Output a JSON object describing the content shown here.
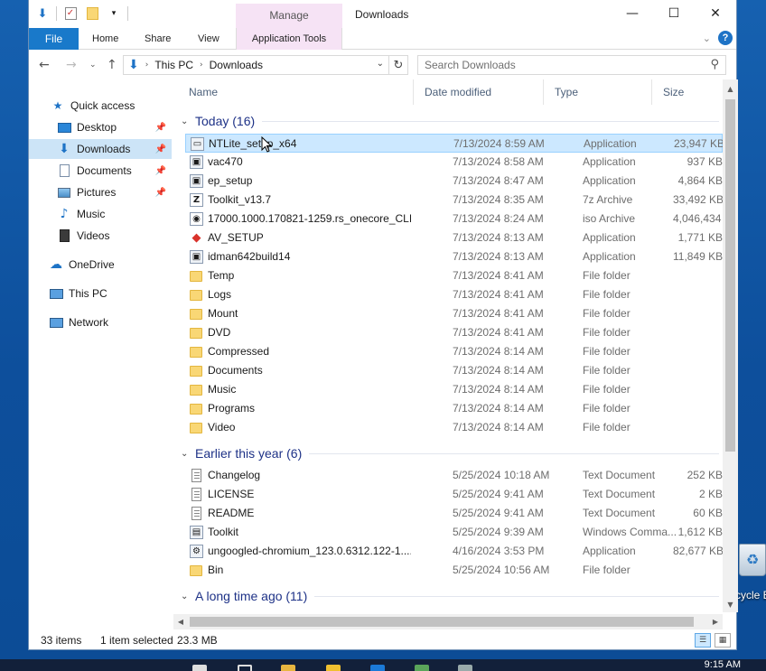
{
  "window": {
    "title": "Downloads",
    "manage_tab": "Manage",
    "minimize_glyph": "—",
    "maximize_glyph": "☐",
    "close_glyph": "✕"
  },
  "ribbon": {
    "file": "File",
    "home": "Home",
    "share": "Share",
    "view": "View",
    "app_tools": "Application Tools",
    "help": "?"
  },
  "address": {
    "crumbs": [
      "This PC",
      "Downloads"
    ],
    "search_placeholder": "Search Downloads"
  },
  "nav": {
    "quick_access": "Quick access",
    "desktop": "Desktop",
    "downloads": "Downloads",
    "documents": "Documents",
    "pictures": "Pictures",
    "music": "Music",
    "videos": "Videos",
    "onedrive": "OneDrive",
    "this_pc": "This PC",
    "network": "Network"
  },
  "columns": {
    "name": "Name",
    "date": "Date modified",
    "type": "Type",
    "size": "Size"
  },
  "groups": {
    "today": "Today (16)",
    "earlier": "Earlier this year (6)",
    "long_ago": "A long time ago (11)"
  },
  "rows": [
    {
      "name": "NTLite_setup_x64",
      "date": "7/13/2024 8:59 AM",
      "type": "Application",
      "size": "23,947 KB",
      "icon": "installer-icon"
    },
    {
      "name": "vac470",
      "date": "7/13/2024 8:58 AM",
      "type": "Application",
      "size": "937 KB",
      "icon": "app-icon"
    },
    {
      "name": "ep_setup",
      "date": "7/13/2024 8:47 AM",
      "type": "Application",
      "size": "4,864 KB",
      "icon": "app-icon"
    },
    {
      "name": "Toolkit_v13.7",
      "date": "7/13/2024 8:35 AM",
      "type": "7z Archive",
      "size": "33,492 KB",
      "icon": "archive-icon"
    },
    {
      "name": "17000.1000.170821-1259.rs_onecore_CLIE...",
      "date": "7/13/2024 8:24 AM",
      "type": "iso Archive",
      "size": "4,046,434 KB",
      "icon": "iso-icon"
    },
    {
      "name": "AV_SETUP",
      "date": "7/13/2024 8:13 AM",
      "type": "Application",
      "size": "1,771 KB",
      "icon": "av-icon"
    },
    {
      "name": "idman642build14",
      "date": "7/13/2024 8:13 AM",
      "type": "Application",
      "size": "11,849 KB",
      "icon": "app-icon"
    },
    {
      "name": "Temp",
      "date": "7/13/2024 8:41 AM",
      "type": "File folder",
      "size": "",
      "icon": "folder-icon"
    },
    {
      "name": "Logs",
      "date": "7/13/2024 8:41 AM",
      "type": "File folder",
      "size": "",
      "icon": "folder-icon"
    },
    {
      "name": "Mount",
      "date": "7/13/2024 8:41 AM",
      "type": "File folder",
      "size": "",
      "icon": "folder-icon"
    },
    {
      "name": "DVD",
      "date": "7/13/2024 8:41 AM",
      "type": "File folder",
      "size": "",
      "icon": "folder-icon"
    },
    {
      "name": "Compressed",
      "date": "7/13/2024 8:14 AM",
      "type": "File folder",
      "size": "",
      "icon": "folder-icon"
    },
    {
      "name": "Documents",
      "date": "7/13/2024 8:14 AM",
      "type": "File folder",
      "size": "",
      "icon": "folder-icon"
    },
    {
      "name": "Music",
      "date": "7/13/2024 8:14 AM",
      "type": "File folder",
      "size": "",
      "icon": "folder-icon"
    },
    {
      "name": "Programs",
      "date": "7/13/2024 8:14 AM",
      "type": "File folder",
      "size": "",
      "icon": "folder-icon"
    },
    {
      "name": "Video",
      "date": "7/13/2024 8:14 AM",
      "type": "File folder",
      "size": "",
      "icon": "folder-icon"
    },
    {
      "name": "Changelog",
      "date": "5/25/2024 10:18 AM",
      "type": "Text Document",
      "size": "252 KB",
      "icon": "text-document-icon"
    },
    {
      "name": "LICENSE",
      "date": "5/25/2024 9:41 AM",
      "type": "Text Document",
      "size": "2 KB",
      "icon": "text-document-icon"
    },
    {
      "name": "README",
      "date": "5/25/2024 9:41 AM",
      "type": "Text Document",
      "size": "60 KB",
      "icon": "text-document-icon"
    },
    {
      "name": "Toolkit",
      "date": "5/25/2024 9:39 AM",
      "type": "Windows Comma...",
      "size": "1,612 KB",
      "icon": "command-script-icon"
    },
    {
      "name": "ungoogled-chromium_123.0.6312.122-1....",
      "date": "4/16/2024 3:53 PM",
      "type": "Application",
      "size": "82,677 KB",
      "icon": "setup-icon"
    },
    {
      "name": "Bin",
      "date": "5/25/2024 10:56 AM",
      "type": "File folder",
      "size": "",
      "icon": "folder-icon"
    }
  ],
  "status": {
    "items": "33 items",
    "selected": "1 item selected",
    "size": "23.3 MB"
  },
  "desktop": {
    "recycle_label": "cycle B",
    "clock": "9:15 AM"
  },
  "colors": {
    "accent": "#1979ca",
    "selection": "#cce8ff",
    "manage_tab": "#f6e3f5",
    "folder": "#f9d775",
    "group_header": "#1e3287"
  }
}
